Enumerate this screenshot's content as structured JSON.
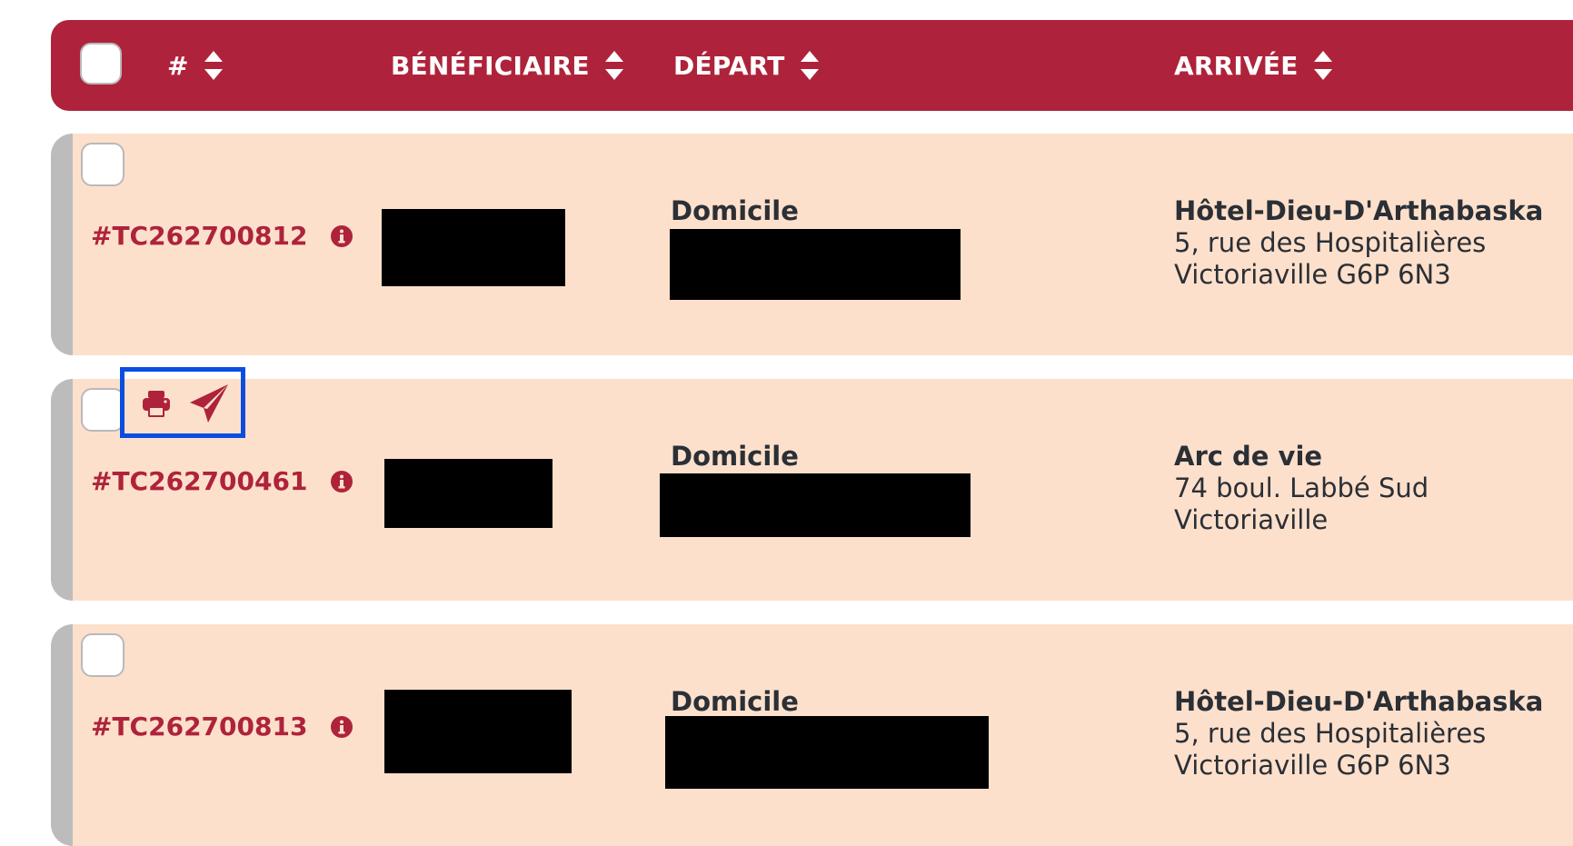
{
  "header": {
    "columns": [
      {
        "label": "#"
      },
      {
        "label": "BÉNÉFICIAIRE"
      },
      {
        "label": "DÉPART"
      },
      {
        "label": "ARRIVÉE"
      }
    ]
  },
  "rows": [
    {
      "id": "#TC262700812",
      "departure_label": "Domicile",
      "arrival": {
        "name": "Hôtel-Dieu-D'Arthabaska",
        "line1": "5, rue des Hospitalières",
        "line2": "Victoriaville  G6P 6N3"
      }
    },
    {
      "id": "#TC262700461",
      "departure_label": "Domicile",
      "arrival": {
        "name": "Arc de vie",
        "line1": "74 boul. Labbé Sud",
        "line2": "Victoriaville"
      }
    },
    {
      "id": "#TC262700813",
      "departure_label": "Domicile",
      "arrival": {
        "name": "Hôtel-Dieu-D'Arthabaska",
        "line1": "5, rue des Hospitalières",
        "line2": "Victoriaville  G6P 6N3"
      }
    }
  ],
  "icons": {
    "sort": "sort-icon",
    "info": "info-icon",
    "print": "print-icon",
    "send": "send-icon"
  },
  "colors": {
    "header_bg": "#ae233b",
    "row_bg": "#fde0cb",
    "accent": "#ae233b",
    "row_stripe": "#bdbcbd",
    "highlight_border": "#0a4ee0"
  }
}
